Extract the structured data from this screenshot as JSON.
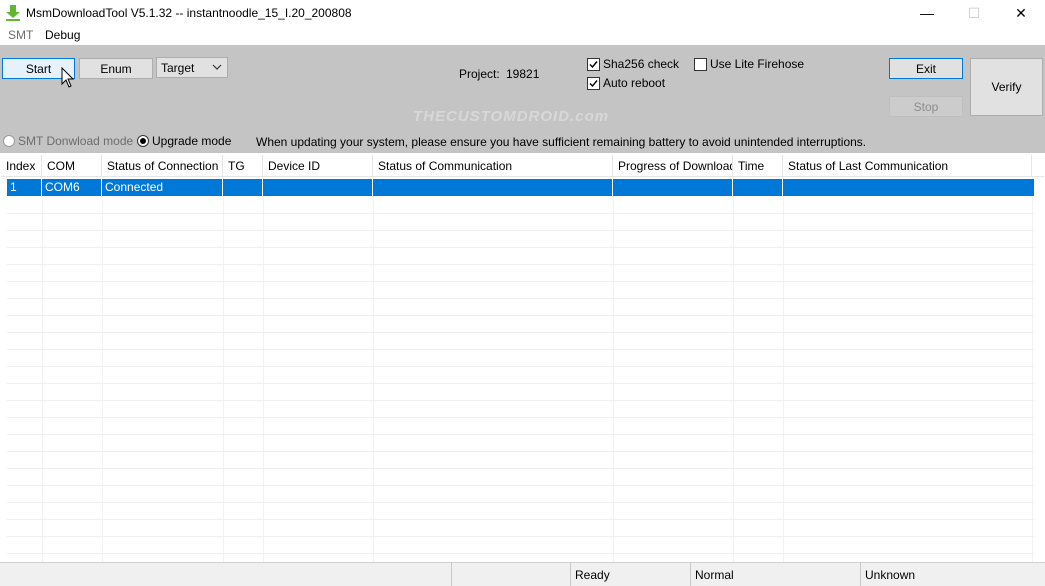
{
  "window": {
    "title": "MsmDownloadTool V5.1.32 -- instantnoodle_15_I.20_200808",
    "minimize": "—",
    "maximize": "☐",
    "close": "✕"
  },
  "menu": {
    "smt": "SMT",
    "debug": "Debug"
  },
  "toolbar": {
    "start_label": "Start",
    "enum_label": "Enum",
    "target_value": "Target",
    "project_label": "Project:",
    "project_value": "19821",
    "sha256_label": "Sha256 check",
    "sha256_checked": true,
    "auto_reboot_label": "Auto reboot",
    "auto_reboot_checked": true,
    "lite_firehose_label": "Use Lite Firehose",
    "lite_firehose_checked": false,
    "exit_label": "Exit",
    "stop_label": "Stop",
    "verify_label": "Verify",
    "watermark": "THECUSTOMDROID.com"
  },
  "mode": {
    "smt_label": "SMT Donwload mode",
    "upgrade_label": "Upgrade mode",
    "selected": "upgrade",
    "warning": "When updating your system, please ensure you have sufficient remaining battery to avoid unintended interruptions."
  },
  "table": {
    "columns": [
      "Index",
      "COM",
      "Status of Connection",
      "TG",
      "Device ID",
      "Status of Communication",
      "Progress of Download",
      "Time",
      "Status of Last Communication"
    ],
    "rows": [
      [
        "1",
        "COM6",
        "Connected",
        "",
        "",
        "",
        "",
        "",
        ""
      ]
    ]
  },
  "statusbar": {
    "ready": "Ready",
    "normal": "Normal",
    "unknown": "Unknown"
  },
  "colors": {
    "accent": "#0078d7",
    "panel": "#c4c4c4",
    "app_icon": "#5fb832"
  }
}
